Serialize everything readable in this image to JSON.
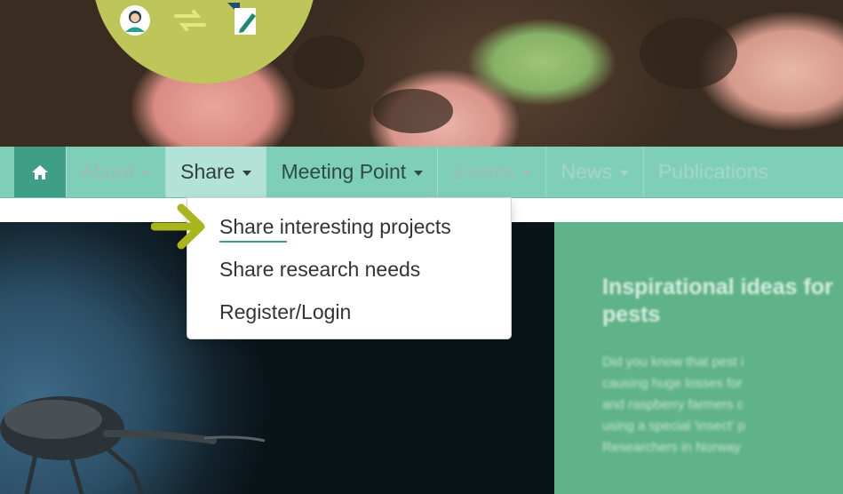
{
  "navbar": {
    "home_icon": "home-icon",
    "items": [
      {
        "label": "About"
      },
      {
        "label": "Share"
      },
      {
        "label": "Meeting Point"
      },
      {
        "label": "Events"
      },
      {
        "label": "News"
      },
      {
        "label": "Publications"
      }
    ]
  },
  "dropdown": {
    "items": [
      {
        "label": "Share interesting projects"
      },
      {
        "label": "Share research needs"
      },
      {
        "label": "Register/Login"
      }
    ]
  },
  "feature": {
    "title": "Inspirational ideas for pests",
    "text": "Did you know that pest i\ncausing huge losses for\nand raspberry farmers c\nusing a special 'insect' p\nResearchers in Norway"
  },
  "badge": {
    "icons": [
      "person-icon",
      "exchange-arrows-icon",
      "document-pen-icon"
    ]
  },
  "colors": {
    "navbar": "#7fcfb8",
    "home": "#3f9e86",
    "active": "#b3e3d6",
    "badge": "#bec65a",
    "arrow": "#a8b51c",
    "feature_bg": "#60b389"
  }
}
